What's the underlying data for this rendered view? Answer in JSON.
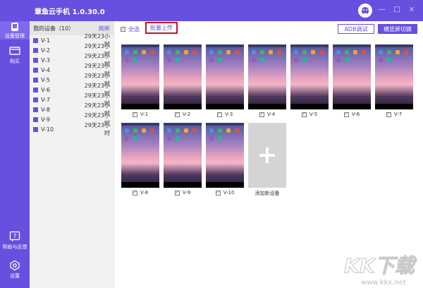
{
  "app": {
    "title": "章鱼云手机 1.0.30.0"
  },
  "window_controls": {
    "minimize": "—",
    "maximize": "□",
    "close": "×"
  },
  "sidebar": {
    "items": [
      {
        "label": "设备管理",
        "icon": "device-icon"
      },
      {
        "label": "购买",
        "icon": "purchase-icon"
      },
      {
        "label": "帮助与反馈",
        "icon": "help-icon"
      },
      {
        "label": "设置",
        "icon": "settings-icon"
      }
    ]
  },
  "device_panel": {
    "title": "我的设备（10）",
    "refresh": "刷新",
    "devices": [
      {
        "name": "V-1",
        "time": "29天23小时"
      },
      {
        "name": "V-2",
        "time": "29天23小时"
      },
      {
        "name": "V-3",
        "time": "29天23小时"
      },
      {
        "name": "V-4",
        "time": "29天23小时"
      },
      {
        "name": "V-5",
        "time": "29天23小时"
      },
      {
        "name": "V-6",
        "time": "29天23小时"
      },
      {
        "name": "V-7",
        "time": "29天23小时"
      },
      {
        "name": "V-8",
        "time": "29天23小时"
      },
      {
        "name": "V-9",
        "time": "29天23小时"
      },
      {
        "name": "V-10",
        "time": "29天23小时"
      }
    ]
  },
  "toolbar": {
    "select_all": "全选",
    "batch_upload": "批量上传",
    "adb_debug": "ADB调试",
    "orientation_switch": "横竖屏切换"
  },
  "grid": {
    "phones": [
      {
        "label": "V-1"
      },
      {
        "label": "V-2"
      },
      {
        "label": "V-3"
      },
      {
        "label": "V-4"
      },
      {
        "label": "V-5"
      },
      {
        "label": "V-6"
      },
      {
        "label": "V-7"
      },
      {
        "label": "V-8"
      },
      {
        "label": "V-9"
      },
      {
        "label": "V-10"
      }
    ],
    "add_device": "添加新设备"
  },
  "watermark": {
    "text": "KK下载",
    "url": "www.kkx.net"
  },
  "colors": {
    "accent": "#6650e0",
    "highlight": "#c8102e"
  }
}
